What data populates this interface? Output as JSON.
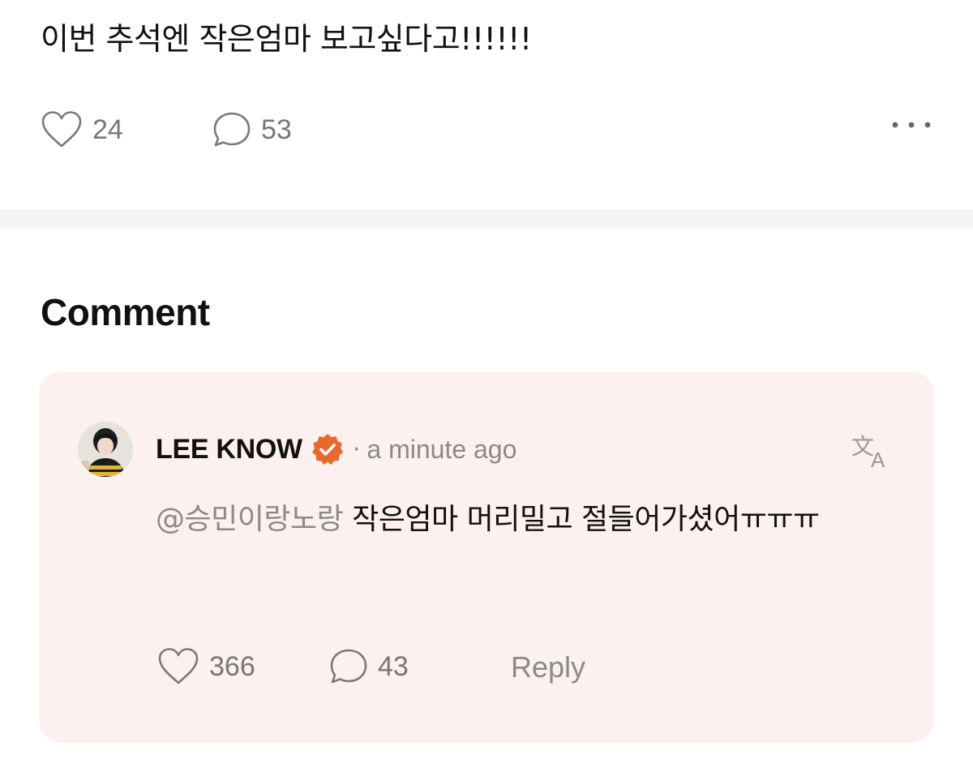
{
  "post": {
    "text": "이번 추석엔 작은엄마 보고싶다고!!!!!!",
    "like_count": "24",
    "comment_count": "53"
  },
  "comments_section": {
    "heading": "Comment"
  },
  "comment": {
    "author": "LEE KNOW",
    "separator": "·",
    "time": "a minute ago",
    "mention": "@승민이랑노랑",
    "body": " 작은엄마 머리밀고 절들어가셨어ㅠㅠㅠ",
    "like_count": "366",
    "reply_count": "43",
    "reply_label": "Reply"
  },
  "colors": {
    "card_background": "#fcf1ee",
    "verified_badge": "#e8692d",
    "muted_text": "#8a8a8a"
  },
  "icons": [
    "heart-icon",
    "speech-bubble-icon",
    "more-dots-icon",
    "verified-badge-icon",
    "translate-icon"
  ]
}
